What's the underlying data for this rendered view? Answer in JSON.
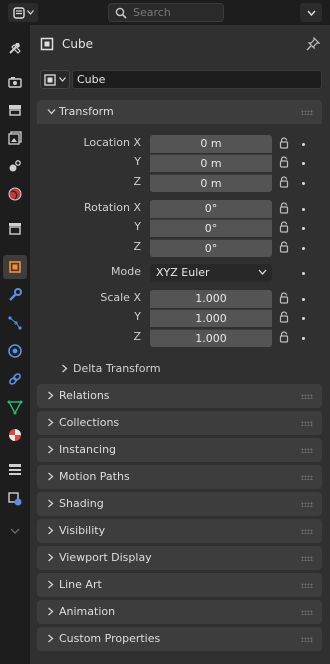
{
  "topbar": {
    "search_placeholder": "Search"
  },
  "header": {
    "object_name": "Cube"
  },
  "name_field": {
    "value": "Cube"
  },
  "transform": {
    "title": "Transform",
    "location_label": "Location X",
    "location": [
      {
        "axis": "Y",
        "value": "0 m"
      }
    ],
    "location_x": "0 m",
    "location_y_label": "Y",
    "location_y": "0 m",
    "location_z_label": "Z",
    "location_z": "0 m",
    "rotation_label": "Rotation X",
    "rotation_x": "0°",
    "rotation_y_label": "Y",
    "rotation_y": "0°",
    "rotation_z_label": "Z",
    "rotation_z": "0°",
    "mode_label": "Mode",
    "mode_value": "XYZ Euler",
    "scale_label": "Scale X",
    "scale_x": "1.000",
    "scale_y_label": "Y",
    "scale_y": "1.000",
    "scale_z_label": "Z",
    "scale_z": "1.000",
    "delta_title": "Delta Transform"
  },
  "panels": [
    {
      "title": "Relations"
    },
    {
      "title": "Collections"
    },
    {
      "title": "Instancing"
    },
    {
      "title": "Motion Paths"
    },
    {
      "title": "Shading"
    },
    {
      "title": "Visibility"
    },
    {
      "title": "Viewport Display"
    },
    {
      "title": "Line Art"
    },
    {
      "title": "Animation"
    },
    {
      "title": "Custom Properties"
    }
  ],
  "tabs": [
    {
      "icon": "tool-icon"
    },
    {
      "icon": "render-icon"
    },
    {
      "icon": "output-icon"
    },
    {
      "icon": "view-layer-icon"
    },
    {
      "icon": "scene-icon"
    },
    {
      "icon": "world-icon"
    },
    {
      "icon": "collection-icon"
    },
    {
      "icon": "object-icon",
      "active": true
    },
    {
      "icon": "modifier-icon"
    },
    {
      "icon": "particles-icon"
    },
    {
      "icon": "physics-icon"
    },
    {
      "icon": "constraints-icon"
    },
    {
      "icon": "object-data-icon"
    },
    {
      "icon": "material-icon"
    },
    {
      "icon": "texture-icon"
    },
    {
      "icon": "shader-fx-icon"
    }
  ],
  "colors": {
    "active_tab_icon": "#ff8b2e",
    "panel_bg": "#3d3d3d",
    "field_bg": "#545454",
    "bg": "#303030"
  }
}
